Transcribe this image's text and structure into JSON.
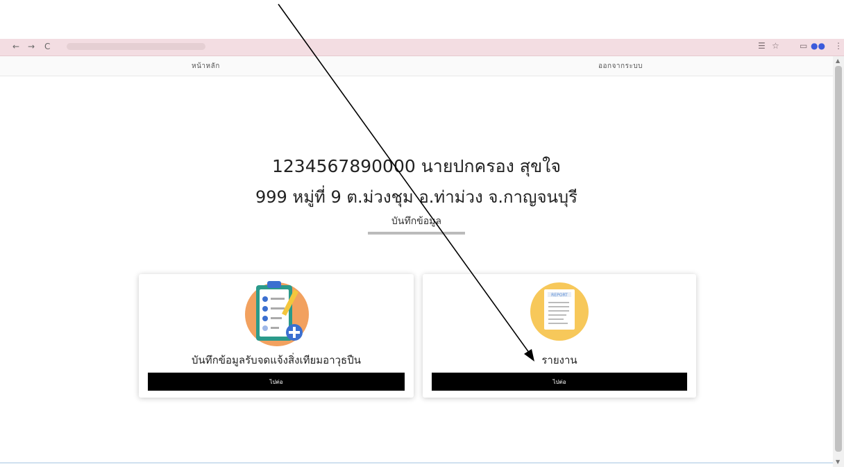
{
  "browser": {
    "nav_back": "←",
    "nav_forward": "→",
    "nav_reload": "C"
  },
  "nav": {
    "home": "หน้าหลัก",
    "logout": "ออกจากระบบ"
  },
  "profile": {
    "line1": "1234567890000 นายปกครอง สุขใจ",
    "line2": "999 หมู่ที่ 9  ต.ม่วงชุม อ.ท่าม่วง จ.กาญจนบุรี",
    "section_title": "บันทึกข้อมูล"
  },
  "cards": [
    {
      "title": "บันทึกข้อมูลรับจดแจ้งสิ่งเทียมอาวุธปืน",
      "button": "ไปต่อ",
      "icon": "clipboard-checklist-icon"
    },
    {
      "title": "รายงาน",
      "button": "ไปต่อ",
      "icon": "report-document-icon"
    }
  ],
  "colors": {
    "button_bg": "#000000",
    "icon_orange": "#f2a15f",
    "icon_yellow": "#f7c85a",
    "chrome_bg": "#f3dde2"
  }
}
